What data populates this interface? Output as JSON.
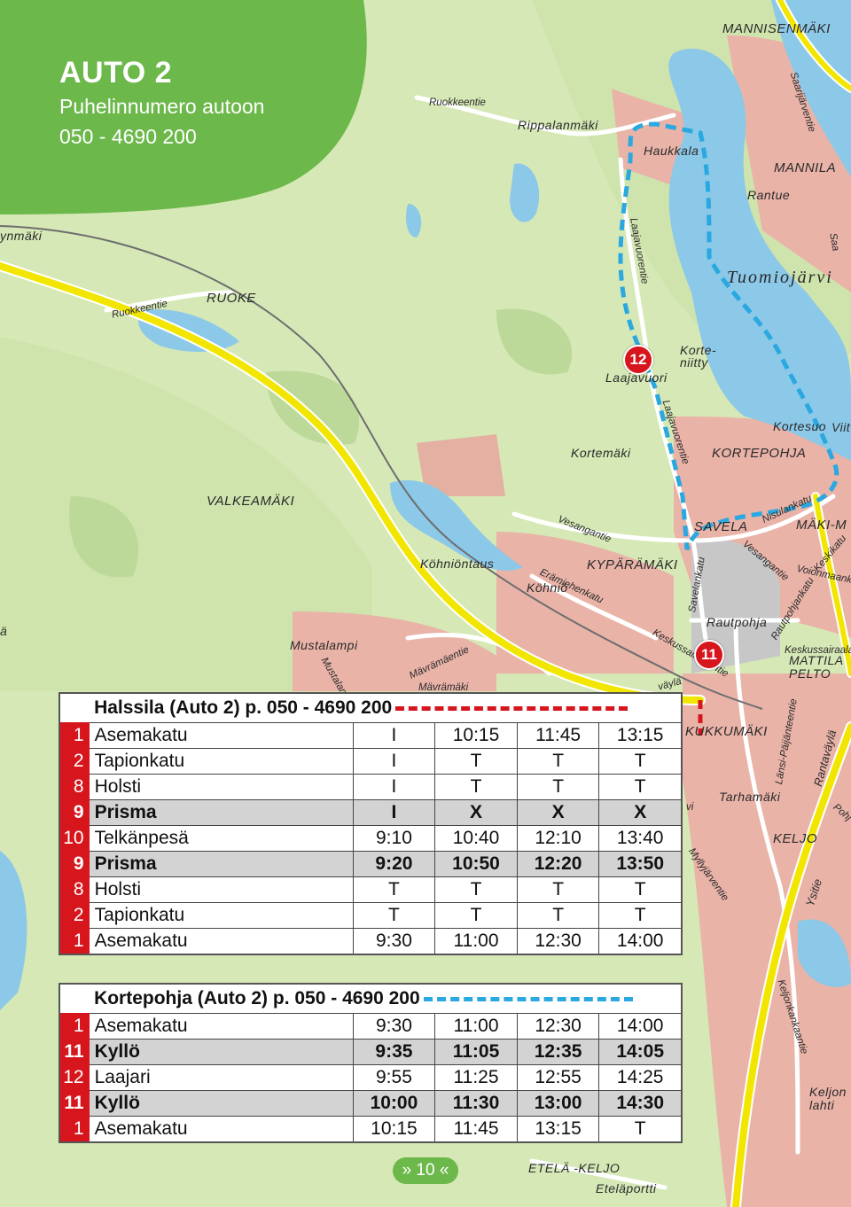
{
  "header": {
    "title": "AUTO 2",
    "phone_label": "Puhelinnumero autoon",
    "phone_number": "050 - 4690 200"
  },
  "map": {
    "places": {
      "mannisenmaki": "MANNISENMÄKI",
      "mannila": "MANNILA",
      "rantue": "Rantue",
      "haukkala": "Haukkala",
      "rippalanmaki": "Rippalanmäki",
      "ruoke": "RUOKE",
      "ynmaki": "ynmäki",
      "korteniitty": "Korte-\nniitty",
      "laajavuori": "Laajavuori",
      "kortesuo": "Kortesuo",
      "viit": "Viit",
      "kortemaki": "Kortemäki",
      "kortepohja": "KORTEPOHJA",
      "valkeamaki": "VALKEAMÄKI",
      "savela": "SAVELA",
      "maki_m": "MÄKI-M",
      "kohniontaus": "Köhniöntaus",
      "kyparamaki": "KYPÄRÄMÄKI",
      "kohnio": "Köhniö",
      "rautpohja": "Rautpohja",
      "mustalampi": "Mustalampi",
      "mattila_pelto": "MATTILA\nPELTO",
      "kukkumaki": "KUKKUMÄKI",
      "tarhamaki": "Tarhamäki",
      "keljo": "KELJO",
      "keljonlahti": "Keljon\nlahti",
      "eta_keljo": "ETELÄ -KELJO",
      "etelaportti": "Eteläportti",
      "a_left": "ä"
    },
    "streets": {
      "ruokkeentie_top": "Ruokkeentie",
      "ruokkeentie_left": "Ruokkeentie",
      "saarijarventie": "Saarijärventie",
      "laajavuorentie_top": "Laajavuorentie",
      "laajavuorentie_mid": "Laajavuorentie",
      "vesangantie": "Vesangantie",
      "vesangantie_right": "Vesangantie",
      "nisulankatu": "Nisulankatu",
      "keskikatu": "Keskikatu",
      "voionmaankatu": "Voionmaanka",
      "savelankatu": "Savelankatu",
      "eramiehenkatu": "Erämiehenkatu",
      "rautpohjankatu": "Rautpohjankatu",
      "keskussairaalantie": "Keskussairaalantie",
      "keskussairaalan_right": "Keskussairaalan",
      "mavramaentie": "Mävrämäentie",
      "musta_partial": "Mustalam",
      "mavramaki_partial": "Mävrämäki",
      "vayla": "väylä",
      "lansi_paijanteentie": "Länsi-Päijänteentie",
      "rantavayla": "Rantaväylä",
      "myllyjarventie": "Myllyjärventie",
      "ysitie": "Ysitie",
      "keljonkankaantie": "Keljonkankaantie",
      "pohj": "Pohj",
      "vi": "vi",
      "saa": "Saa"
    },
    "lake": "Tuomiojärvi",
    "stop_markers": [
      "12",
      "11"
    ]
  },
  "timetable_red": {
    "title": "Halssila (Auto 2) p. 050 - 4690 200",
    "rows": [
      {
        "num": "1",
        "stop": "Asemakatu",
        "bold": false,
        "times": [
          "I",
          "10:15",
          "11:45",
          "13:15"
        ]
      },
      {
        "num": "2",
        "stop": "Tapionkatu",
        "bold": false,
        "times": [
          "I",
          "T",
          "T",
          "T"
        ]
      },
      {
        "num": "8",
        "stop": "Holsti",
        "bold": false,
        "times": [
          "I",
          "T",
          "T",
          "T"
        ]
      },
      {
        "num": "9",
        "stop": "Prisma",
        "bold": true,
        "times": [
          "I",
          "X",
          "X",
          "X"
        ]
      },
      {
        "num": "10",
        "stop": "Telkänpesä",
        "bold": false,
        "times": [
          "9:10",
          "10:40",
          "12:10",
          "13:40"
        ]
      },
      {
        "num": "9",
        "stop": "Prisma",
        "bold": true,
        "times": [
          "9:20",
          "10:50",
          "12:20",
          "13:50"
        ]
      },
      {
        "num": "8",
        "stop": "Holsti",
        "bold": false,
        "times": [
          "T",
          "T",
          "T",
          "T"
        ]
      },
      {
        "num": "2",
        "stop": "Tapionkatu",
        "bold": false,
        "times": [
          "T",
          "T",
          "T",
          "T"
        ]
      },
      {
        "num": "1",
        "stop": "Asemakatu",
        "bold": false,
        "times": [
          "9:30",
          "11:00",
          "12:30",
          "14:00"
        ]
      }
    ]
  },
  "timetable_blue": {
    "title": "Kortepohja (Auto 2) p. 050 - 4690 200",
    "rows": [
      {
        "num": "1",
        "stop": "Asemakatu",
        "bold": false,
        "times": [
          "9:30",
          "11:00",
          "12:30",
          "14:00"
        ]
      },
      {
        "num": "11",
        "stop": "Kyllö",
        "bold": true,
        "times": [
          "9:35",
          "11:05",
          "12:35",
          "14:05"
        ]
      },
      {
        "num": "12",
        "stop": "Laajari",
        "bold": false,
        "times": [
          "9:55",
          "11:25",
          "12:55",
          "14:25"
        ]
      },
      {
        "num": "11",
        "stop": "Kyllö",
        "bold": true,
        "times": [
          "10:00",
          "11:30",
          "13:00",
          "14:30"
        ]
      },
      {
        "num": "1",
        "stop": "Asemakatu",
        "bold": false,
        "times": [
          "10:15",
          "11:45",
          "13:15",
          "T"
        ]
      }
    ]
  },
  "page_indicator": "» 10 «",
  "colors": {
    "header_green": "#6cb84a",
    "route_red": "#d6161c",
    "route_blue": "#2aa8e0",
    "water": "#8cc8e8",
    "major_road": "#f2e600",
    "urban": "#e8a8a0"
  }
}
